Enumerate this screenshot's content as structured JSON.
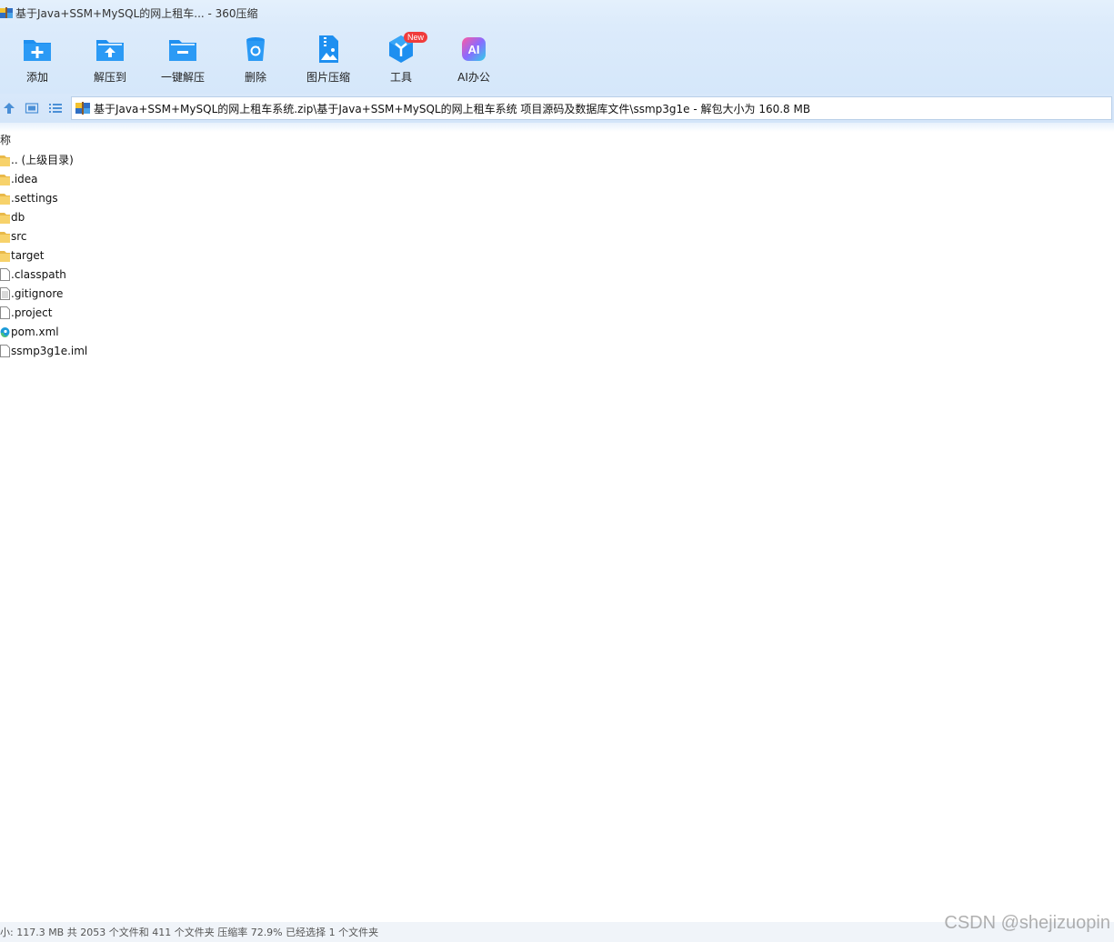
{
  "window": {
    "title": "基于Java+SSM+MySQL的网上租车... - 360压缩"
  },
  "toolbar": {
    "items": [
      {
        "label": "添加",
        "icon": "add-folder-icon"
      },
      {
        "label": "解压到",
        "icon": "extract-to-icon"
      },
      {
        "label": "一键解压",
        "icon": "one-click-extract-icon"
      },
      {
        "label": "删除",
        "icon": "delete-icon"
      },
      {
        "label": "图片压缩",
        "icon": "image-compress-icon"
      },
      {
        "label": "工具",
        "icon": "tools-icon",
        "badge": "New"
      },
      {
        "label": "AI办公",
        "icon": "ai-office-icon"
      }
    ]
  },
  "address": {
    "path": "基于Java+SSM+MySQL的网上租车系统.zip\\基于Java+SSM+MySQL的网上租车系统 项目源码及数据库文件\\ssmp3g1e - 解包大小为 160.8 MB"
  },
  "filelist": {
    "header_name": "称",
    "items": [
      {
        "name": ".. (上级目录)",
        "type": "folder"
      },
      {
        "name": ".idea",
        "type": "folder"
      },
      {
        "name": ".settings",
        "type": "folder"
      },
      {
        "name": "db",
        "type": "folder"
      },
      {
        "name": "src",
        "type": "folder"
      },
      {
        "name": "target",
        "type": "folder"
      },
      {
        "name": ".classpath",
        "type": "file"
      },
      {
        "name": ".gitignore",
        "type": "text-file"
      },
      {
        "name": ".project",
        "type": "file"
      },
      {
        "name": "pom.xml",
        "type": "edge-file"
      },
      {
        "name": "ssmp3g1e.iml",
        "type": "file"
      }
    ]
  },
  "status": {
    "text": "小: 117.3 MB 共 2053 个文件和 411 个文件夹 压缩率 72.9% 已经选择 1 个文件夹"
  },
  "watermark": {
    "text": "CSDN @shejizuopin"
  },
  "colors": {
    "accent_blue": "#1e8ff0",
    "folder_yellow": "#f7d26b",
    "badge_red": "#f03c3c"
  }
}
